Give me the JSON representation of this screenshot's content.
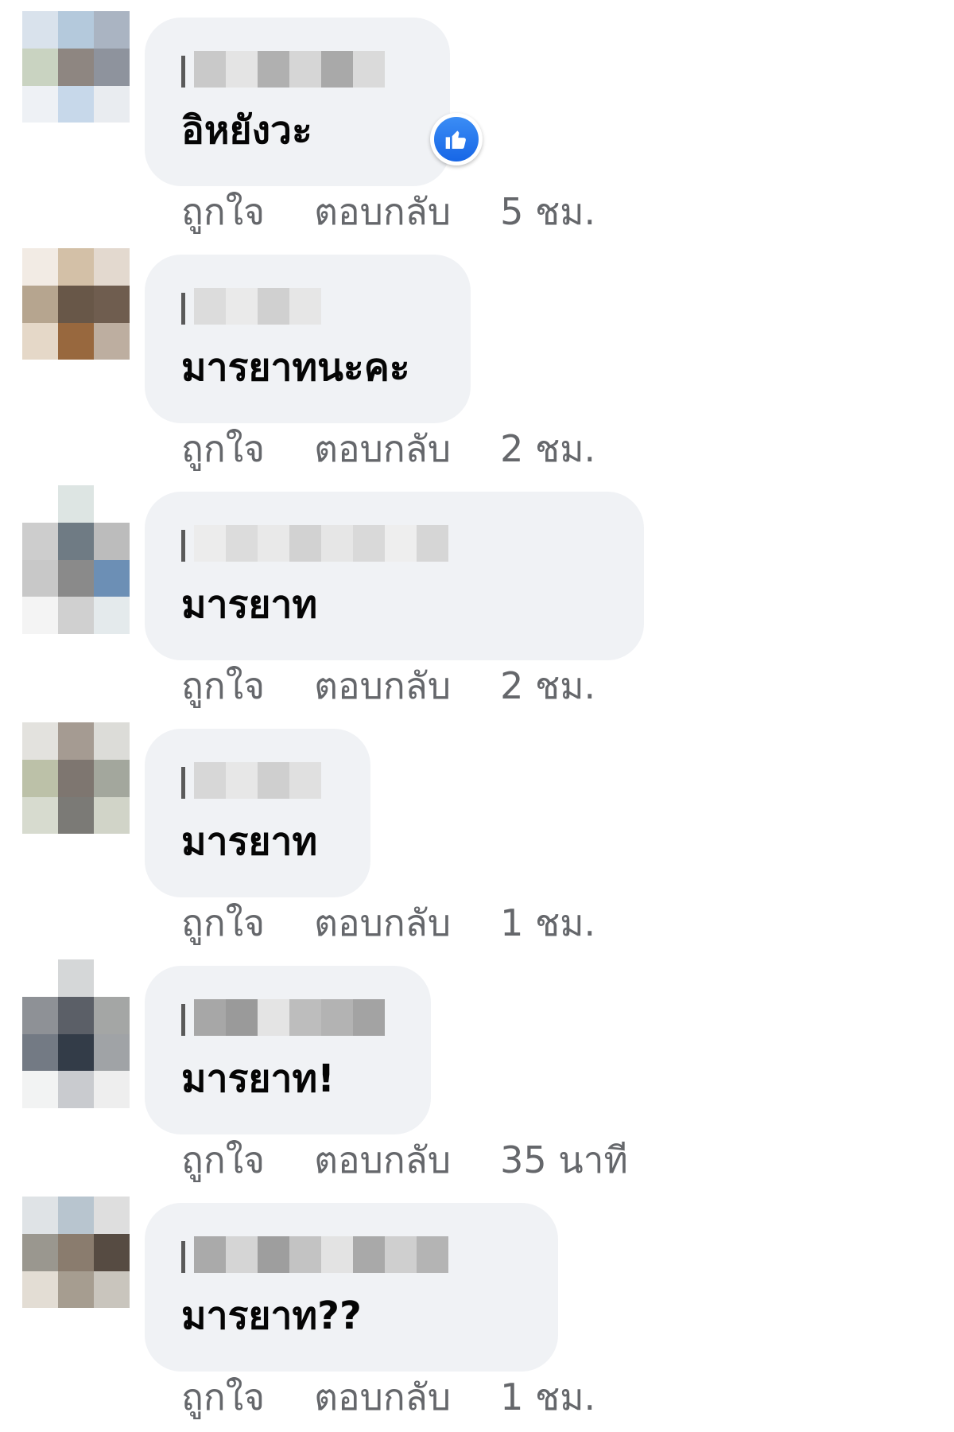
{
  "comments": [
    {
      "text": "อิหยังวะ",
      "like_label": "ถูกใจ",
      "reply_label": "ตอบกลับ",
      "time": "5 ชม.",
      "has_like_reaction": true,
      "avatar_colors": [
        "#d9e2ec",
        "#b4c9dc",
        "#aab4c2",
        "#c9d3c1",
        "#8e8681",
        "#8e939d",
        "#eef1f5",
        "#c7d8ea",
        "#e9ecf0",
        "#ffffff",
        "#ffffff",
        "#ffffff"
      ],
      "name_blur_colors": [
        "#c9c9c9",
        "#e4e4e4",
        "#b0b0b0",
        "#d6d6d6",
        "#a9a9a9",
        "#dadada"
      ]
    },
    {
      "text": "มารยาทนะคะ",
      "like_label": "ถูกใจ",
      "reply_label": "ตอบกลับ",
      "time": "2 ชม.",
      "has_like_reaction": false,
      "avatar_colors": [
        "#f2ebe4",
        "#d3c0a7",
        "#e3d9cf",
        "#b6a58f",
        "#685748",
        "#6f5d4f",
        "#e5d8c8",
        "#98683e",
        "#bdaea0",
        "#ffffff",
        "#ffffff",
        "#ffffff"
      ],
      "name_blur_colors": [
        "#dcdcdc",
        "#eaeaea",
        "#d0d0d0",
        "#e6e6e6"
      ]
    },
    {
      "text": "มารยาท",
      "like_label": "ถูกใจ",
      "reply_label": "ตอบกลับ",
      "time": "2 ชม.",
      "has_like_reaction": false,
      "avatar_colors": [
        "#ffffff",
        "#dde5e3",
        "#ffffff",
        "#cdcdcd",
        "#6f7b84",
        "#bcbcbc",
        "#c8c8c8",
        "#8a8a8a",
        "#6c8fb5",
        "#f4f4f4",
        "#d0d0d0",
        "#e4eaec"
      ],
      "name_blur_colors": [
        "#ececec",
        "#dcdcdc",
        "#e9e9e9",
        "#d2d2d2",
        "#e6e6e6",
        "#d9d9d9",
        "#eeeeee",
        "#d6d6d6"
      ]
    },
    {
      "text": "มารยาท",
      "like_label": "ถูกใจ",
      "reply_label": "ตอบกลับ",
      "time": "1 ชม.",
      "has_like_reaction": false,
      "avatar_colors": [
        "#e3e2de",
        "#a59b92",
        "#dcdcd8",
        "#bcc1a8",
        "#7e7670",
        "#a3a79d",
        "#d7dbcf",
        "#7b7a76",
        "#d1d4c8",
        "#ffffff",
        "#ffffff",
        "#ffffff"
      ],
      "name_blur_colors": [
        "#d7d7d7",
        "#e7e7e7",
        "#cfcfcf",
        "#e0e0e0"
      ]
    },
    {
      "text": "มารยาท!",
      "like_label": "ถูกใจ",
      "reply_label": "ตอบกลับ",
      "time": "35 นาที",
      "has_like_reaction": false,
      "avatar_colors": [
        "#ffffff",
        "#d5d7d8",
        "#ffffff",
        "#8e9196",
        "#5b5f67",
        "#a4a6a5",
        "#737a84",
        "#333c48",
        "#a0a3a6",
        "#f2f3f3",
        "#c9cbcf",
        "#eeeeee"
      ],
      "name_blur_colors": [
        "#a7a7a7",
        "#9a9a9a",
        "#e4e4e4",
        "#bdbdbd",
        "#b3b3b3",
        "#a3a3a3"
      ]
    },
    {
      "text": "มารยาท??",
      "like_label": "ถูกใจ",
      "reply_label": "ตอบกลับ",
      "time": "1 ชม.",
      "has_like_reaction": false,
      "avatar_colors": [
        "#dfe3e6",
        "#b8c5cf",
        "#dedede",
        "#9a978f",
        "#8a7c6e",
        "#564b42",
        "#e3ddd4",
        "#a69d90",
        "#c9c5bd",
        "#ffffff",
        "#ffffff",
        "#ffffff"
      ],
      "name_blur_colors": [
        "#aaaaaa",
        "#d5d5d5",
        "#9e9e9e",
        "#c3c3c3",
        "#e3e3e3",
        "#a9a9a9",
        "#cfcfcf",
        "#b4b4b4"
      ]
    }
  ],
  "colors": {
    "bubble": "#f0f2f5",
    "text": "#050505",
    "meta": "#65676b",
    "like_blue": "#1877f2"
  },
  "icons": {
    "like_reaction": "thumbs-up-icon"
  }
}
